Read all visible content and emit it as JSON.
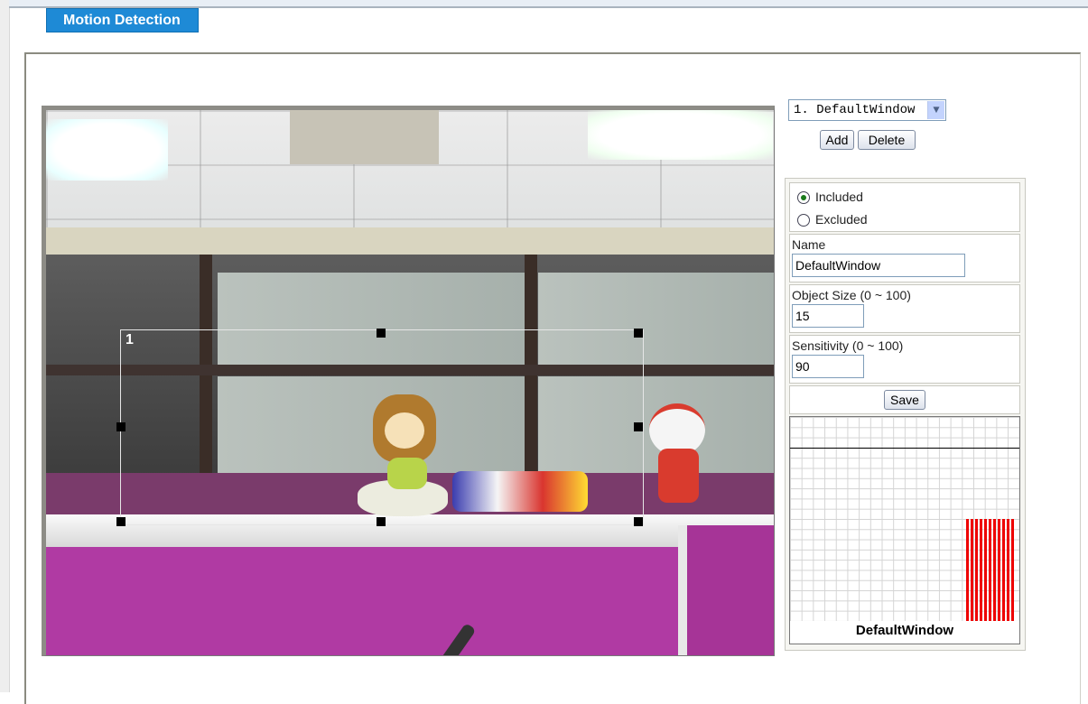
{
  "header": {
    "tab_label": "Motion Detection"
  },
  "video": {
    "region_number": "1"
  },
  "window_selector": {
    "selected": "1. DefaultWindow"
  },
  "buttons": {
    "add": "Add",
    "delete": "Delete",
    "save": "Save"
  },
  "settings": {
    "mode_options": [
      {
        "label": "Included",
        "checked": true
      },
      {
        "label": "Excluded",
        "checked": false
      }
    ],
    "name_label": "Name",
    "name_value": "DefaultWindow",
    "object_size_label": "Object Size  (0 ~ 100)",
    "object_size_value": "15",
    "sensitivity_label": "Sensitivity  (0 ~ 100)",
    "sensitivity_value": "90"
  },
  "graph": {
    "label": "DefaultWindow",
    "threshold_percent": 85,
    "bar_color": "#ee0000",
    "recent_levels_percent": [
      50,
      50,
      50,
      50,
      50,
      50,
      50,
      50,
      50,
      50,
      50
    ]
  },
  "colors": {
    "tab_background": "#1e8ad6",
    "tab_text": "#ffffff"
  }
}
